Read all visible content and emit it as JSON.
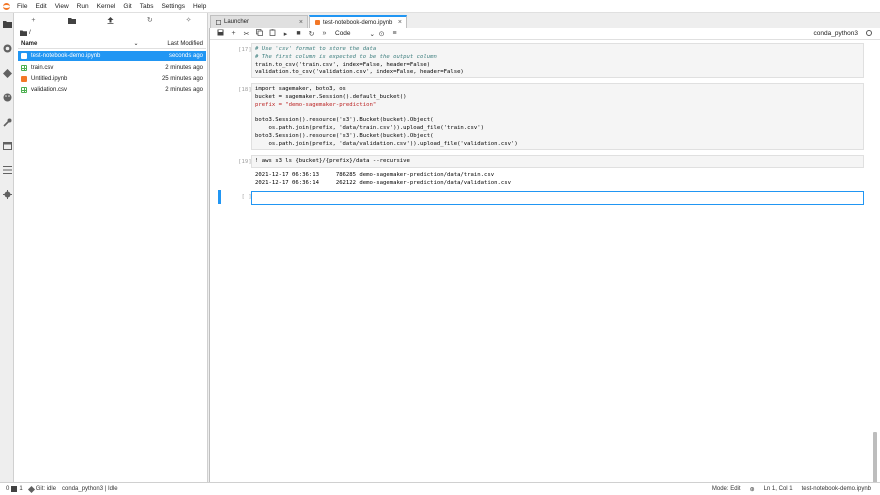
{
  "menubar": {
    "items": [
      "File",
      "Edit",
      "View",
      "Run",
      "Kernel",
      "Git",
      "Tabs",
      "Settings",
      "Help"
    ]
  },
  "sidebar": {
    "icons": [
      "folder-icon",
      "running-icon",
      "git-icon",
      "palette-icon",
      "wrench-icon",
      "tabs-icon",
      "toc-icon",
      "extension-icon"
    ]
  },
  "filebrowser": {
    "toolbar": [
      "+",
      "▰",
      "⤒",
      "↻",
      "✧"
    ],
    "breadcrumb": "/",
    "header": {
      "name": "Name",
      "modified": "Last Modified"
    },
    "files": [
      {
        "name": "test-notebook-demo.ipynb",
        "modified": "seconds ago",
        "type": "notebook",
        "selected": true
      },
      {
        "name": "train.csv",
        "modified": "2 minutes ago",
        "type": "csv",
        "selected": false
      },
      {
        "name": "Untitled.ipynb",
        "modified": "25 minutes ago",
        "type": "notebook",
        "selected": false
      },
      {
        "name": "validation.csv",
        "modified": "2 minutes ago",
        "type": "csv",
        "selected": false
      }
    ]
  },
  "tabs": [
    {
      "label": "Launcher",
      "active": false
    },
    {
      "label": "test-notebook-demo.ipynb",
      "active": true
    }
  ],
  "notebook": {
    "toolbar": {
      "cell_type": "Code",
      "kernel": "conda_python3"
    },
    "cells": [
      {
        "prompt": "[17]:",
        "lines": [
          "# Use 'csv' format to store the data",
          "# The first column is expected to be the output column",
          "train.to_csv('train.csv', index=False, header=False)",
          "validation.to_csv('validation.csv', index=False, header=False)"
        ]
      },
      {
        "prompt": "[18]:",
        "lines": [
          "import sagemaker, boto3, os",
          "bucket = sagemaker.Session().default_bucket()",
          "prefix = \"demo-sagemaker-prediction\"",
          "",
          "boto3.Session().resource('s3').Bucket(bucket).Object(",
          "    os.path.join(prefix, 'data/train.csv')).upload_file('train.csv')",
          "boto3.Session().resource('s3').Bucket(bucket).Object(",
          "    os.path.join(prefix, 'data/validation.csv')).upload_file('validation.csv')"
        ]
      },
      {
        "prompt": "[19]:",
        "lines": [
          "! aws s3 ls {bucket}/{prefix}/data --recursive"
        ],
        "output": [
          "2021-12-17 06:36:13     786285 demo-sagemaker-prediction/data/train.csv",
          "2021-12-17 06:36:14     262122 demo-sagemaker-prediction/data/validation.csv"
        ]
      },
      {
        "prompt": "[ ]:",
        "lines": [
          ""
        ]
      }
    ]
  },
  "statusbar": {
    "zero": "0",
    "terminals": "1",
    "git": "Git: idle",
    "kernel_status": "conda_python3 | Idle",
    "mode": "Mode: Edit",
    "cursor": "Ln 1, Col 1",
    "filename": "test-notebook-demo.ipynb"
  },
  "colors": {
    "accent": "#2196f3",
    "jupyter_orange": "#f37726",
    "csv_green": "#4caf50"
  }
}
